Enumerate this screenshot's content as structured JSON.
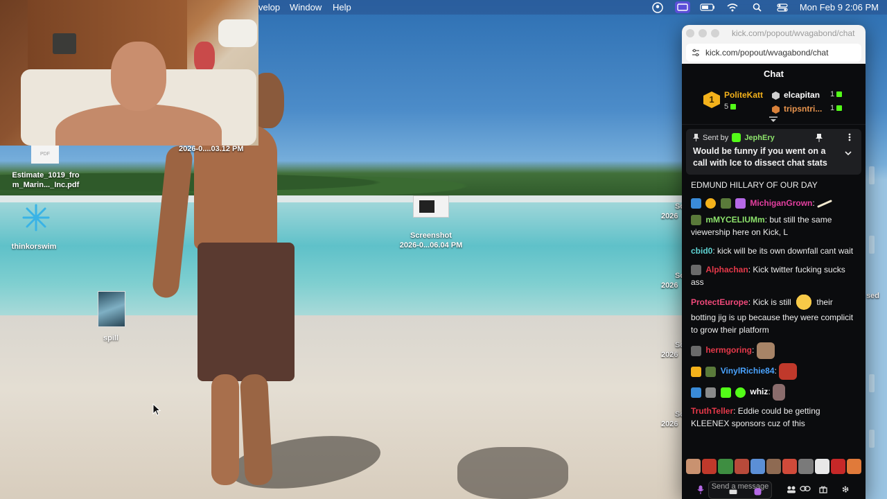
{
  "menubar": {
    "items": [
      "velop",
      "Window",
      "Help"
    ],
    "datetime": "Mon Feb 9  2:06 PM"
  },
  "webcam": {
    "timestamp": "2026-0....03.12 PM"
  },
  "desktop": {
    "pdf_label": "PDF",
    "pdf_file_line1": "Estimate_1019_fro",
    "pdf_file_line2": "m_Marin..._Inc.pdf",
    "tos_label": "thinkorswim",
    "screenshot_line1": "Screenshot",
    "screenshot_line2": "2026-0...06.04 PM",
    "spill_label": "spill",
    "edge_items": [
      "Sc",
      "2026",
      "Sc",
      "2026",
      "sed",
      "Sc",
      "2026",
      "Sc",
      "2026",
      "Sc",
      "2026",
      "Sc",
      "2026"
    ]
  },
  "browser": {
    "window_title": "kick.com/popout/wvagabond/chat",
    "url": "kick.com/popout/wvagabond/chat"
  },
  "chat": {
    "header": "Chat",
    "leaderboard": {
      "rank": "1",
      "first": {
        "name": "PoliteKatt",
        "count": "5"
      },
      "second": {
        "name": "elcapitan",
        "count": "1"
      },
      "third": {
        "name": "tripsntri...",
        "count": "1"
      }
    },
    "pinned": {
      "sent_by_label": "Sent by",
      "user": "JephEry",
      "text": "Would be funny if you went on a call with Ice to dissect chat stats"
    },
    "messages": [
      {
        "user": "",
        "text": "EDMUND HILLARY OF OUR DAY",
        "color": "#ffffff"
      },
      {
        "user": "MichiganGrown",
        "text": ":",
        "color": "#e53fa0"
      },
      {
        "user": "mMYCELIUMm",
        "text": ": but still the same viewership here on Kick, L",
        "color": "#8de36c"
      },
      {
        "user": "cbid0",
        "text": ": kick will be its own downfall cant wait",
        "color": "#5fd4d4"
      },
      {
        "user": "Alphachan",
        "text": ": Kick twitter fucking sucks ass",
        "color": "#e6394a"
      },
      {
        "user": "ProtectEurope",
        "text": ": Kick is still",
        "text2": " their botting jig is up because they were complicit to grow their platform",
        "color": "#f0497a"
      },
      {
        "user": "hermgoring",
        "text": ":",
        "color": "#e6394a"
      },
      {
        "user": "VinylRichie84",
        "text": ":",
        "color": "#4aa3ff"
      },
      {
        "user": "whiz",
        "text": ":",
        "color": "#ffffff"
      },
      {
        "user": "TruthTeller",
        "text": ": Eddie could be getting KLEENEX sponsors cuz of this",
        "color": "#e6394a"
      }
    ],
    "compose_placeholder": "Send a message"
  },
  "colors": {
    "kick_green": "#53fc18",
    "gold": "#f4b21b",
    "chat_bg": "#0b0c0e"
  }
}
